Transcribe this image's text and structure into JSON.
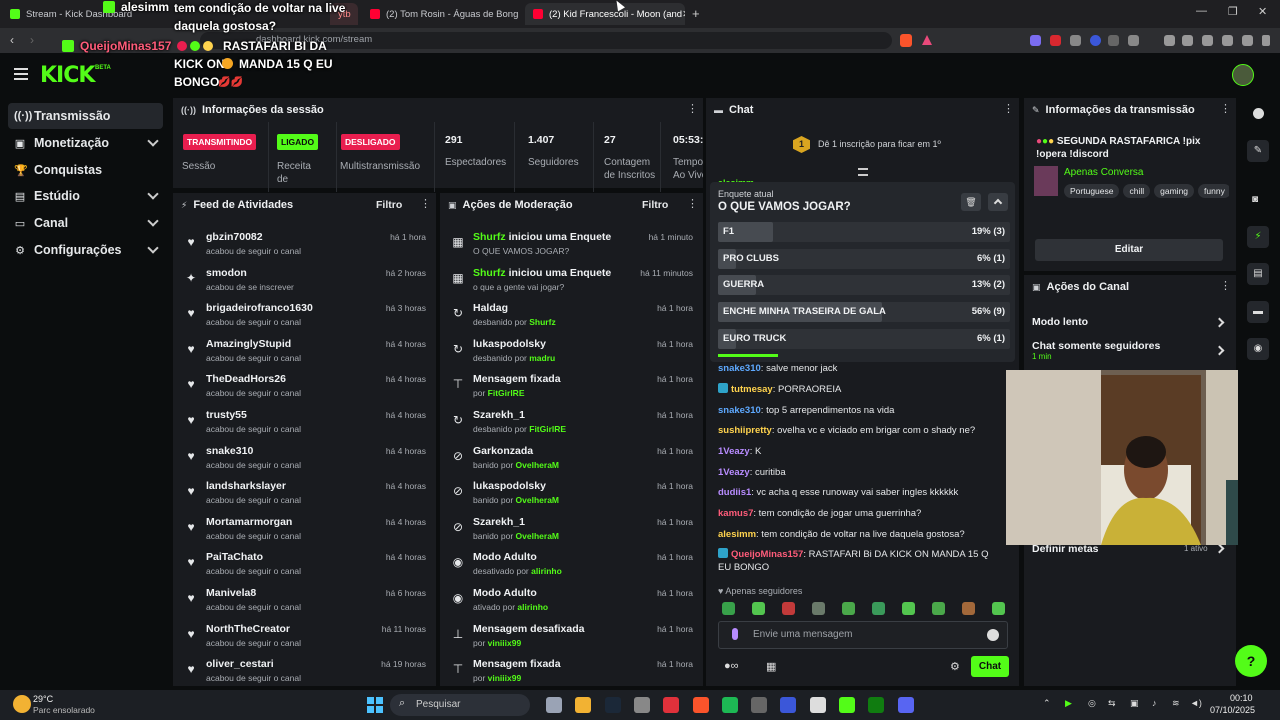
{
  "browser": {
    "tabs": [
      {
        "label": "Stream - Kick Dashboard",
        "active": false
      },
      {
        "label": "ytb",
        "active": false
      },
      {
        "label": "(2) Tom Rosin - Águas de Bong - You",
        "active": false
      },
      {
        "label": "(2) Kid Francescoli - Moon (and",
        "active": true
      }
    ],
    "url": "dashboard.kick.com/stream"
  },
  "overlay": {
    "user1": "alesimm",
    "line1": "tem condição de voltar na live",
    "line1b": "daquela gostosa?",
    "user2": "QueijoMinas157",
    "line2a": "RASTAFARI BI DA",
    "line2b": "KICK ON",
    "line2c": "MANDA 15 Q EU",
    "line2d": "BONGO"
  },
  "header": {
    "logo": "KICK",
    "beta": "BETA"
  },
  "sidebar": {
    "items": [
      {
        "label": "Transmissão",
        "icon": "broadcast-icon",
        "active": true,
        "chevron": false
      },
      {
        "label": "Monetização",
        "icon": "wallet-icon",
        "active": false,
        "chevron": true
      },
      {
        "label": "Conquistas",
        "icon": "trophy-icon",
        "active": false,
        "chevron": false
      },
      {
        "label": "Estúdio",
        "icon": "studio-icon",
        "active": false,
        "chevron": true
      },
      {
        "label": "Canal",
        "icon": "channel-icon",
        "active": false,
        "chevron": true
      },
      {
        "label": "Configurações",
        "icon": "gear-icon",
        "active": false,
        "chevron": true
      }
    ]
  },
  "session": {
    "title": "Informações da sessão",
    "stats": [
      {
        "badge": "TRANSMITINDO",
        "badge_color": "#e91e4f",
        "label": "Sessão"
      },
      {
        "badge": "LIGADO",
        "badge_color": "#53fc18",
        "label": "Receita de"
      },
      {
        "badge": "DESLIGADO",
        "badge_color": "#e91e4f",
        "label": "Multistransmissão"
      },
      {
        "value": "291",
        "label": "Espectadores"
      },
      {
        "value": "1.407",
        "label": "Seguidores"
      },
      {
        "value": "27",
        "label": "Contagem de Inscritos"
      },
      {
        "value": "05:53:",
        "label": "Tempo Ao Vivo"
      }
    ]
  },
  "feed": {
    "title": "Feed de Atividades",
    "filter": "Filtro",
    "rows": [
      {
        "name": "gbzin70082",
        "action": "acabou de seguir o canal",
        "time": "há 1 hora",
        "icon": "heart-icon"
      },
      {
        "name": "smodon",
        "action": "acabou de se inscrever",
        "time": "há 2 horas",
        "icon": "sparkle-icon"
      },
      {
        "name": "brigadeirofranco1630",
        "action": "acabou de seguir o canal",
        "time": "há 3 horas",
        "icon": "heart-icon"
      },
      {
        "name": "AmazinglyStupid",
        "action": "acabou de seguir o canal",
        "time": "há 4 horas",
        "icon": "heart-icon"
      },
      {
        "name": "TheDeadHors26",
        "action": "acabou de seguir o canal",
        "time": "há 4 horas",
        "icon": "heart-icon"
      },
      {
        "name": "trusty55",
        "action": "acabou de seguir o canal",
        "time": "há 4 horas",
        "icon": "heart-icon"
      },
      {
        "name": "snake310",
        "action": "acabou de seguir o canal",
        "time": "há 4 horas",
        "icon": "heart-icon"
      },
      {
        "name": "landsharkslayer",
        "action": "acabou de seguir o canal",
        "time": "há 4 horas",
        "icon": "heart-icon"
      },
      {
        "name": "Mortamarmorgan",
        "action": "acabou de seguir o canal",
        "time": "há 4 horas",
        "icon": "heart-icon"
      },
      {
        "name": "PaiTaChato",
        "action": "acabou de seguir o canal",
        "time": "há 4 horas",
        "icon": "heart-icon"
      },
      {
        "name": "Manivela8",
        "action": "acabou de seguir o canal",
        "time": "há 6 horas",
        "icon": "heart-icon"
      },
      {
        "name": "NorthTheCreator",
        "action": "acabou de seguir o canal",
        "time": "há 11 horas",
        "icon": "heart-icon"
      },
      {
        "name": "oliver_cestari",
        "action": "acabou de seguir o canal",
        "time": "há 19 horas",
        "icon": "heart-icon"
      }
    ]
  },
  "moderation": {
    "title": "Ações de Moderação",
    "filter": "Filtro",
    "rows": [
      {
        "main_hl": "Shurfz",
        "main": " iniciou uma Enquete",
        "sub": "O QUE VAMOS JOGAR?",
        "sub_user": "",
        "time": "há 1 minuto",
        "icon": "poll-icon"
      },
      {
        "main_hl": "Shurfz",
        "main": " iniciou uma Enquete",
        "sub": "o que a gente vai jogar?",
        "sub_user": "",
        "time": "há 11 minutos",
        "icon": "poll-icon"
      },
      {
        "main_hl": "",
        "main": "Haldag",
        "sub": "desbanido por ",
        "sub_user": "Shurfz",
        "time": "há 1 hora",
        "icon": "unban-icon"
      },
      {
        "main_hl": "",
        "main": "lukaspodolsky",
        "sub": "desbanido por ",
        "sub_user": "madru",
        "time": "há 1 hora",
        "icon": "unban-icon"
      },
      {
        "main_hl": "",
        "main": "Mensagem fixada",
        "sub": "por ",
        "sub_user": "FitGirlRE",
        "time": "há 1 hora",
        "icon": "pin-icon"
      },
      {
        "main_hl": "",
        "main": "Szarekh_1",
        "sub": "desbanido por ",
        "sub_user": "FitGirlRE",
        "time": "há 1 hora",
        "icon": "unban-icon"
      },
      {
        "main_hl": "",
        "main": "Garkonzada",
        "sub": "banido por ",
        "sub_user": "OvelheraM",
        "time": "há 1 hora",
        "icon": "ban-icon"
      },
      {
        "main_hl": "",
        "main": "lukaspodolsky",
        "sub": "banido por ",
        "sub_user": "OvelheraM",
        "time": "há 1 hora",
        "icon": "ban-icon"
      },
      {
        "main_hl": "",
        "main": "Szarekh_1",
        "sub": "banido por ",
        "sub_user": "OvelheraM",
        "time": "há 1 hora",
        "icon": "ban-icon"
      },
      {
        "main_hl": "",
        "main": "Modo Adulto",
        "sub": "desativado por ",
        "sub_user": "alirinho",
        "time": "há 1 hora",
        "icon": "eye-icon"
      },
      {
        "main_hl": "",
        "main": "Modo Adulto",
        "sub": "ativado por ",
        "sub_user": "alirinho",
        "time": "há 1 hora",
        "icon": "eye-icon"
      },
      {
        "main_hl": "",
        "main": "Mensagem desafixada",
        "sub": "por ",
        "sub_user": "viniiix99",
        "time": "há 1 hora",
        "icon": "unpin-icon"
      },
      {
        "main_hl": "",
        "main": "Mensagem fixada",
        "sub": "por ",
        "sub_user": "viniiix99",
        "time": "há 1 hora",
        "icon": "pin-icon"
      }
    ]
  },
  "chat": {
    "title": "Chat",
    "sub_goal": "Dê 1 inscrição para ficar em 1º",
    "sub_goal_num": "1",
    "partial_user": "alesimm",
    "poll": {
      "label": "Enquete atual",
      "question": "O QUE VAMOS JOGAR?",
      "options": [
        {
          "label": "F1",
          "result": "19% (3)",
          "pct": 19
        },
        {
          "label": "PRO CLUBS",
          "result": "6% (1)",
          "pct": 6
        },
        {
          "label": "GUERRA",
          "result": "13% (2)",
          "pct": 13
        },
        {
          "label": "ENCHE MINHA TRASEIRA DE GALA",
          "result": "56% (9)",
          "pct": 56
        },
        {
          "label": "EURO TRUCK",
          "result": "6% (1)",
          "pct": 6
        }
      ]
    },
    "messages": [
      {
        "user": "snake310",
        "cls": "u1",
        "text": ": salve menor jack"
      },
      {
        "user": "tutmesay",
        "cls": "u4",
        "text": ": PORRAOREIA"
      },
      {
        "user": "snake310",
        "cls": "u1",
        "text": ": top 5 arrependimentos na vida"
      },
      {
        "user": "sushiipretty",
        "cls": "u4",
        "text": ": ovelha vc e viciado em brigar com o shady ne?"
      },
      {
        "user": "1Veazy",
        "cls": "u3",
        "text": ": K"
      },
      {
        "user": "1Veazy",
        "cls": "u3",
        "text": ": curitiba"
      },
      {
        "user": "dudiis1",
        "cls": "u3",
        "text": ": vc acha q esse runoway vai saber ingles kkkkkk"
      },
      {
        "user": "kamus7",
        "cls": "u2",
        "text": ": tem condição de jogar uma guerrinha?"
      },
      {
        "user": "alesimm",
        "cls": "u4",
        "text": ": tem condição de voltar na live daquela gostosa?"
      },
      {
        "user": "QueijoMinas157",
        "cls": "u2",
        "text": ": RASTAFARI Bi DA KICK ON MANDA 15 Q EU BONGO"
      }
    ],
    "followers_only": "Apenas seguidores",
    "input_placeholder": "Envie uma mensagem",
    "send": "Chat"
  },
  "stream_info": {
    "title": "Informações da transmissão",
    "stream_title": "SEGUNDA RASTAFARICA !pix !opera !discord",
    "category": "Apenas Conversa",
    "tags": [
      "Portuguese",
      "chill",
      "gaming",
      "funny"
    ],
    "edit": "Editar"
  },
  "channel_actions": {
    "title": "Ações do Canal",
    "items": [
      {
        "label": "Modo lento",
        "sub": ""
      },
      {
        "label": "Chat somente seguidores",
        "sub": "1 min"
      }
    ],
    "goals": "Definir metas",
    "goals_status": "1 ativo"
  },
  "taskbar": {
    "weather_temp": "29°C",
    "weather_desc": "Parc ensolarado",
    "search": "Pesquisar",
    "time": "00:10",
    "date": "07/10/2025"
  },
  "colors": {
    "kick_green": "#53fc18",
    "live_red": "#e91e4f",
    "panel": "#191b1f",
    "bg": "#0b0d0e"
  }
}
